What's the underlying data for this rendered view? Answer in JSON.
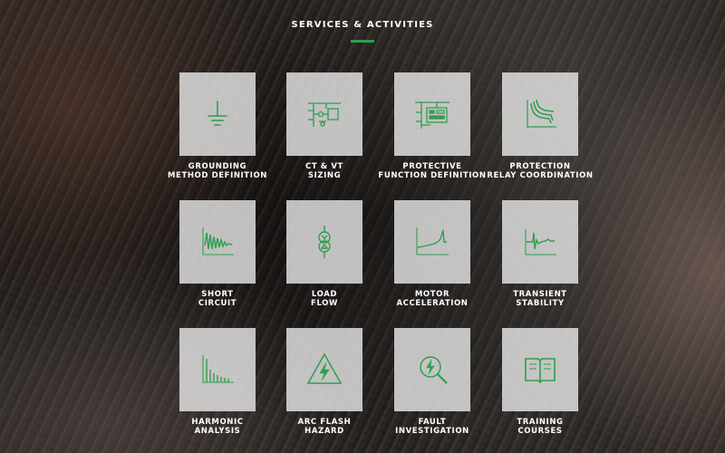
{
  "header": {
    "title": "SERVICES & ACTIVITIES",
    "accent_color": "#2e9e4f"
  },
  "tiles": [
    {
      "line1": "GROUNDING",
      "line2": "METHOD DEFINITION",
      "icon": "ground-symbol-icon"
    },
    {
      "line1": "CT & VT",
      "line2": "SIZING",
      "icon": "ct-vt-schematic-icon"
    },
    {
      "line1": "PROTECTIVE",
      "line2": "FUNCTION DEFINITION",
      "icon": "relay-panel-icon"
    },
    {
      "line1": "PROTECTION",
      "line2": "RELAY COORDINATION",
      "icon": "coordination-curves-icon"
    },
    {
      "line1": "SHORT",
      "line2": "CIRCUIT",
      "icon": "damped-waveform-icon"
    },
    {
      "line1": "LOAD",
      "line2": "FLOW",
      "icon": "transformer-icon"
    },
    {
      "line1": "MOTOR",
      "line2": "ACCELERATION",
      "icon": "acceleration-curve-icon"
    },
    {
      "line1": "TRANSIENT",
      "line2": "STABILITY",
      "icon": "transient-spike-icon"
    },
    {
      "line1": "HARMONIC",
      "line2": "ANALYSIS",
      "icon": "harmonic-bars-icon"
    },
    {
      "line1": "ARC FLASH",
      "line2": "HAZARD",
      "icon": "arc-flash-warning-icon"
    },
    {
      "line1": "FAULT",
      "line2": "INVESTIGATION",
      "icon": "magnifier-bolt-icon"
    },
    {
      "line1": "TRAINING",
      "line2": "COURSES",
      "icon": "open-book-icon"
    }
  ]
}
